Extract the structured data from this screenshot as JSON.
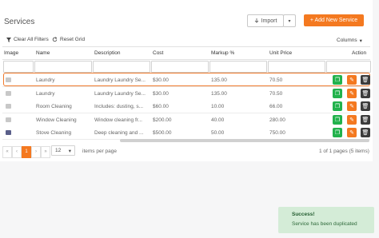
{
  "header": {
    "title": "Services",
    "import_label": "Import",
    "import_caret": "▾",
    "add_label": "+ Add New Service"
  },
  "toolbar": {
    "clear_filters": "Clear All Filters",
    "reset_grid": "Reset Grid",
    "columns_label": "Columns",
    "columns_caret": "▾"
  },
  "table": {
    "columns": [
      "Image",
      "Name",
      "Description",
      "Cost",
      "Markup %",
      "Unit Price",
      "Action"
    ],
    "rows": [
      {
        "name": "Laundry",
        "description": "Laundry Laundry Se...",
        "cost": "$30.00",
        "markup": "135.00",
        "unit_price": "70.50",
        "image": "placeholder"
      },
      {
        "name": "Laundry",
        "description": "Laundry Laundry Se...",
        "cost": "$30.00",
        "markup": "135.00",
        "unit_price": "70.50",
        "image": "placeholder"
      },
      {
        "name": "Room Cleaning",
        "description": "Includes: dusting, s...",
        "cost": "$60.00",
        "markup": "10.00",
        "unit_price": "66.00",
        "image": "placeholder"
      },
      {
        "name": "Window Cleaning",
        "description": "Window cleaning fr...",
        "cost": "$200.00",
        "markup": "40.00",
        "unit_price": "280.00",
        "image": "placeholder"
      },
      {
        "name": "Stove Cleaning",
        "description": "Deep cleaning and ...",
        "cost": "$500.00",
        "markup": "50.00",
        "unit_price": "750.00",
        "image": "photo"
      }
    ],
    "highlighted_row": 0
  },
  "pagination": {
    "first": "«",
    "prev": "‹",
    "current_page": "1",
    "next": "›",
    "last": "»",
    "page_size": "12",
    "page_size_caret": "▾",
    "items_per_page_label": "items per page",
    "pages_info": "1 of 1 pages (5 items)"
  },
  "toast": {
    "title": "Success!",
    "message": "Service has been duplicated"
  },
  "colors": {
    "accent": "#f47920",
    "duplicate": "#22b24c",
    "delete": "#3c3c3c",
    "toast_bg": "#d4ecd7"
  }
}
